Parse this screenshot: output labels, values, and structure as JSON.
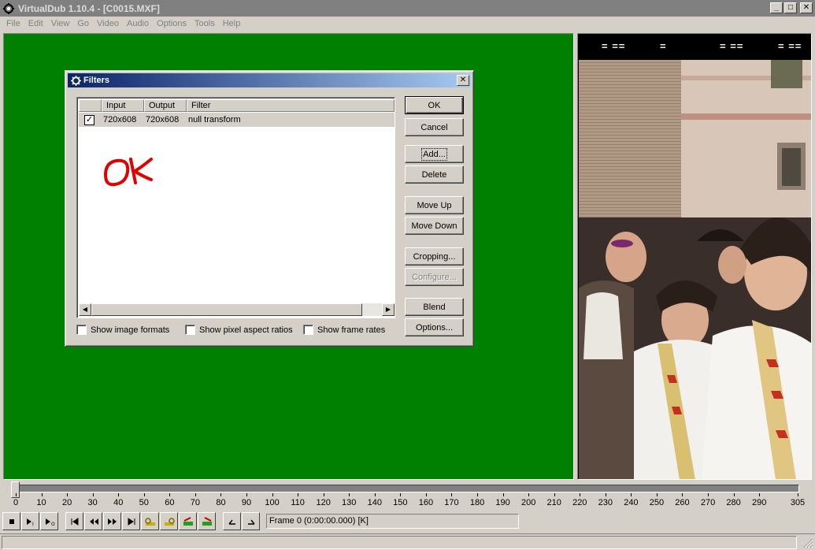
{
  "window": {
    "title": "VirtualDub 1.10.4 - [C0015.MXF]",
    "controls": [
      "_",
      "□",
      "✕"
    ]
  },
  "menu": [
    "File",
    "Edit",
    "View",
    "Go",
    "Video",
    "Audio",
    "Options",
    "Tools",
    "Help"
  ],
  "output_pane": {
    "header_marks": [
      "= ==",
      "=",
      "= ==",
      "= =="
    ]
  },
  "dialog": {
    "title": "Filters",
    "close": "✕",
    "columns": [
      "Input",
      "Output",
      "Filter"
    ],
    "rows": [
      {
        "enabled": true,
        "input": "720x608",
        "output": "720x608",
        "filter": "null transform"
      }
    ],
    "annotation_text": "OK",
    "annotation_color": "#e00000",
    "buttons": {
      "ok": "OK",
      "cancel": "Cancel",
      "add": "Add...",
      "delete": "Delete",
      "move_up": "Move Up",
      "move_down": "Move Down",
      "cropping": "Cropping...",
      "configure": "Configure...",
      "blend": "Blend",
      "options": "Options..."
    },
    "checkboxes": {
      "image_formats": "Show image formats",
      "pixel_aspect": "Show pixel aspect ratios",
      "frame_rates": "Show frame rates"
    }
  },
  "timeline": {
    "ticks": [
      "0",
      "10",
      "20",
      "30",
      "40",
      "50",
      "60",
      "70",
      "80",
      "90",
      "100",
      "110",
      "120",
      "130",
      "140",
      "150",
      "160",
      "170",
      "180",
      "190",
      "200",
      "210",
      "220",
      "230",
      "240",
      "250",
      "260",
      "270",
      "280",
      "290",
      "305"
    ],
    "position": 0
  },
  "frame_status": "Frame 0 (0:00:00.000) [K]",
  "colors": {
    "input_pane": "#008000",
    "title_gradient_start": "#0a246a",
    "title_gradient_end": "#a6caf0",
    "face": "#d4d0c8"
  }
}
